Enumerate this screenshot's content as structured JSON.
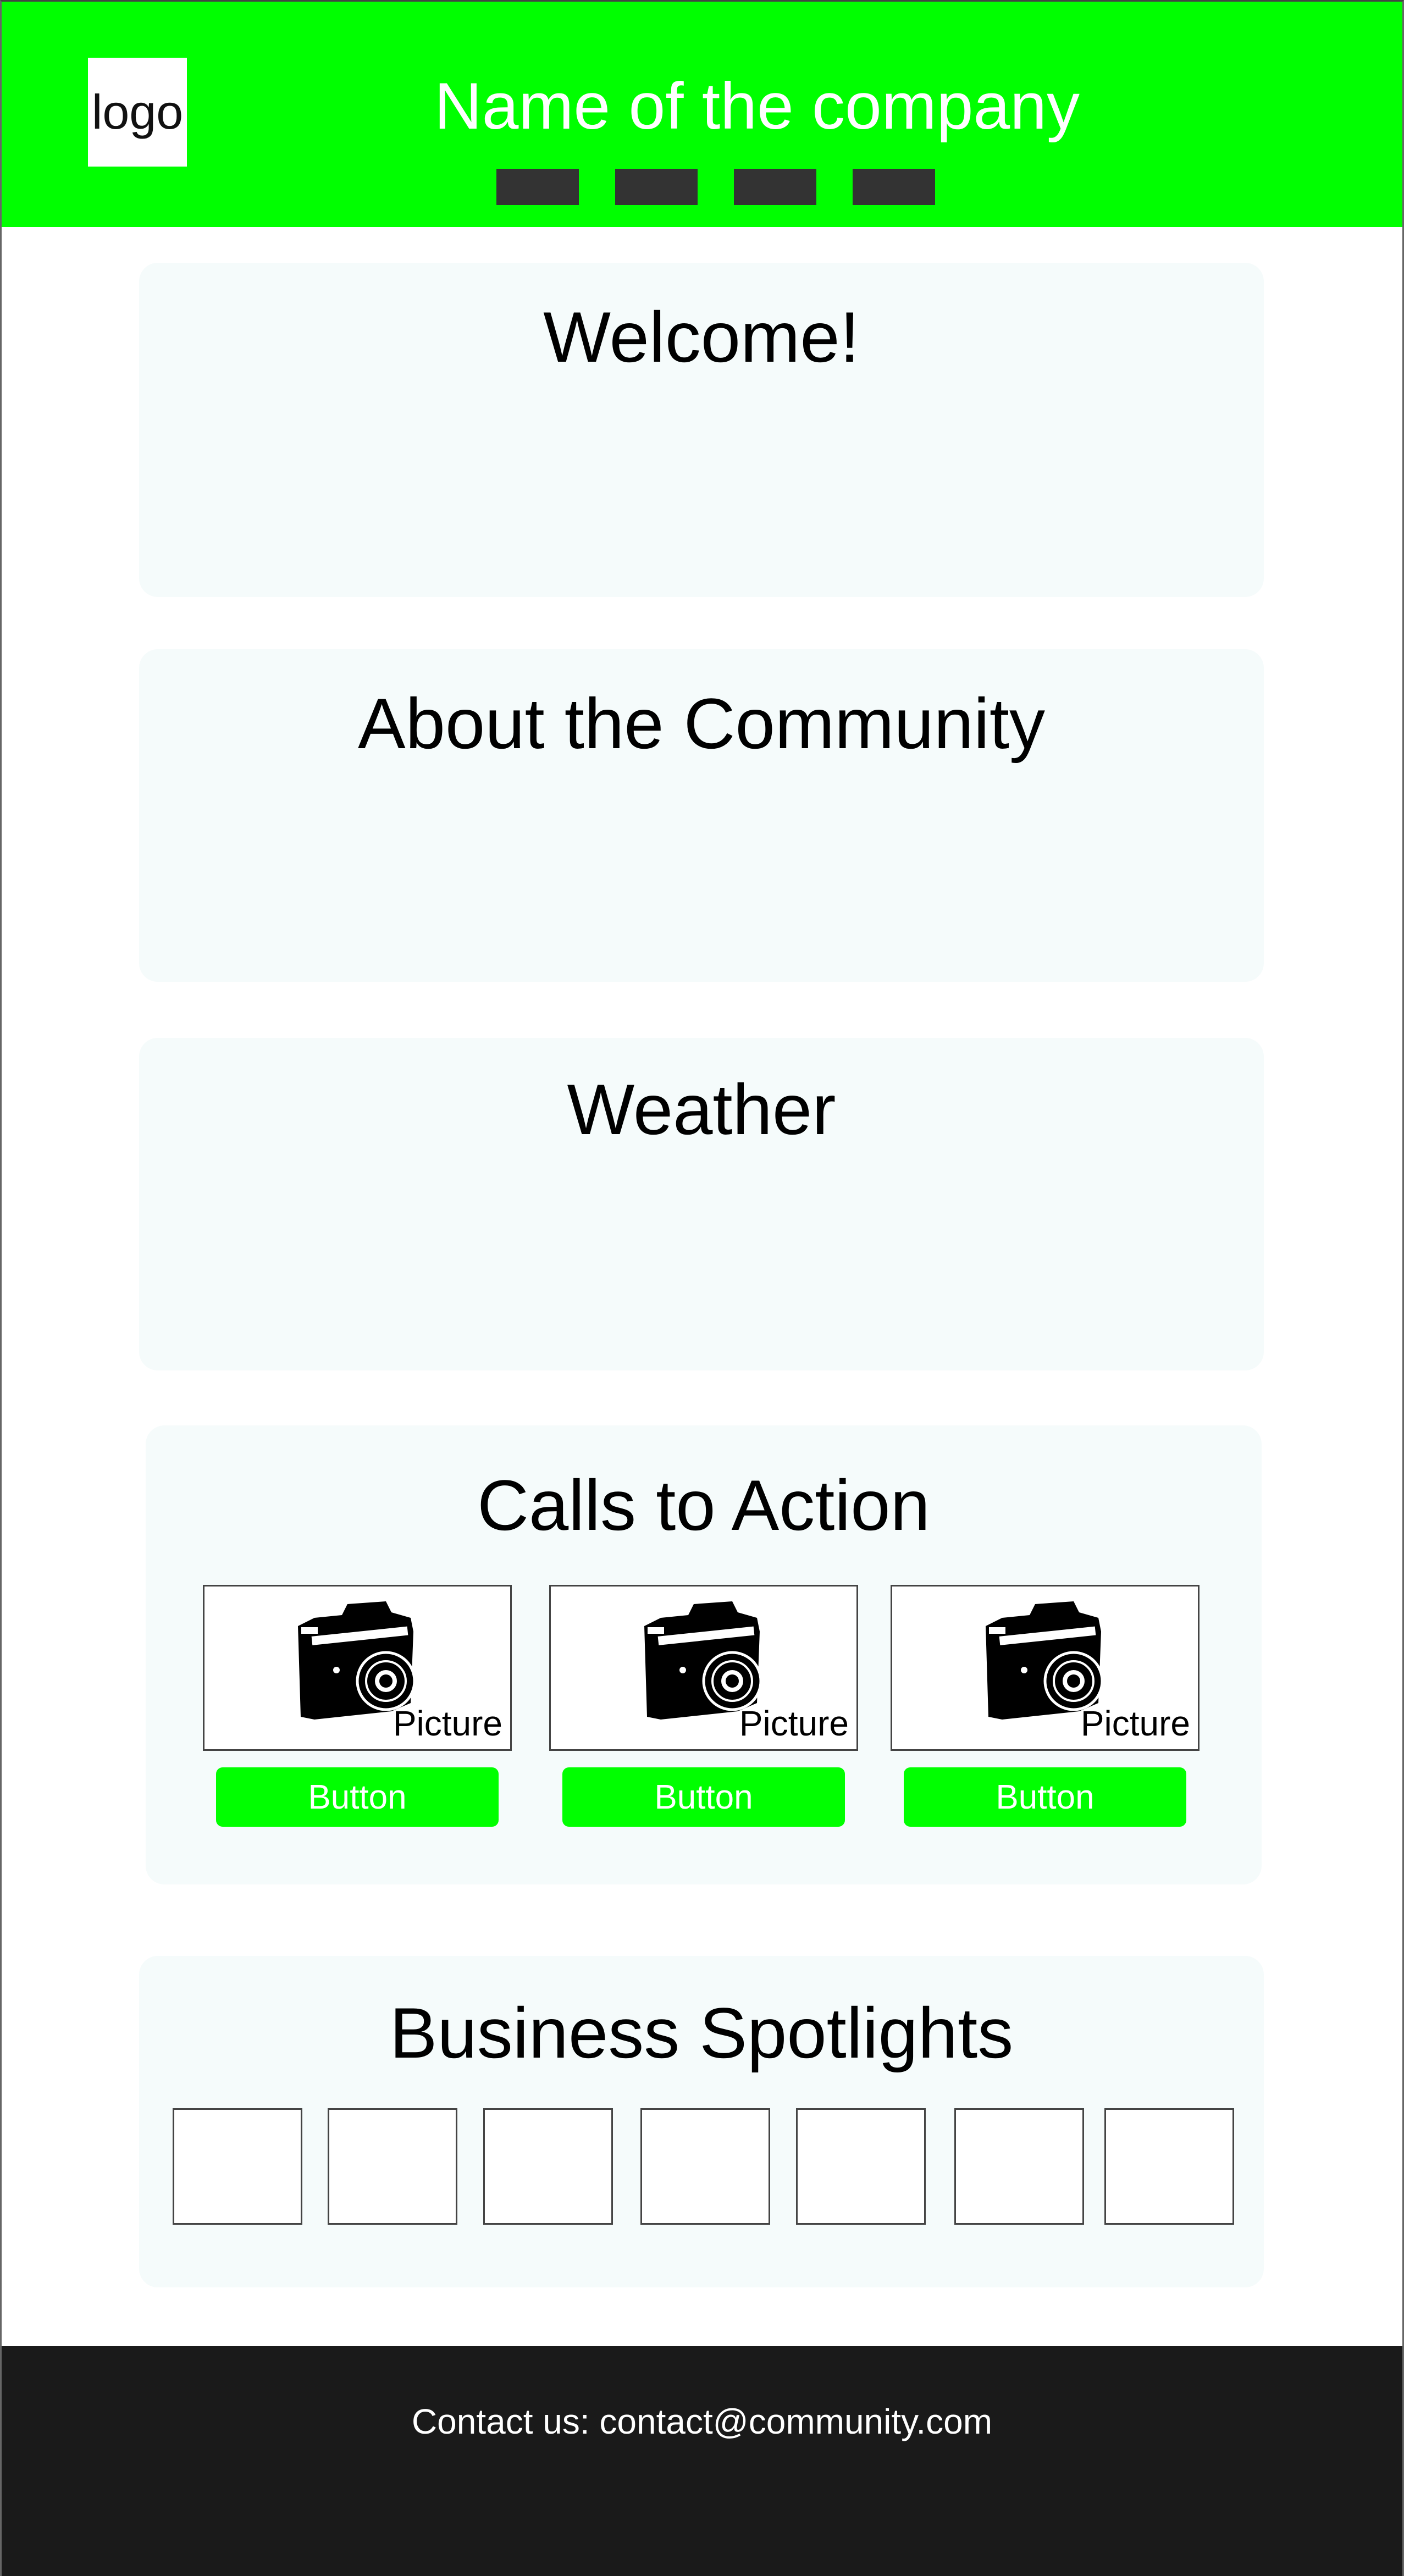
{
  "header": {
    "logo_text": "logo",
    "company_name": "Name of the company",
    "background_color": "#00ff00",
    "nav_items": [
      "",
      "",
      "",
      ""
    ]
  },
  "sections": {
    "welcome": {
      "title": "Welcome!"
    },
    "about": {
      "title": "About the Community"
    },
    "weather": {
      "title": "Weather"
    },
    "cta": {
      "title": "Calls to Action",
      "items": [
        {
          "picture_label": "Picture",
          "icon": "camera-icon",
          "button_label": "Button"
        },
        {
          "picture_label": "Picture",
          "icon": "camera-icon",
          "button_label": "Button"
        },
        {
          "picture_label": "Picture",
          "icon": "camera-icon",
          "button_label": "Button"
        }
      ]
    },
    "spotlights": {
      "title": "Business Spotlights",
      "box_count": 7
    }
  },
  "footer": {
    "contact_text": "Contact us: contact@community.com",
    "background_color": "#1a1a1a"
  },
  "colors": {
    "accent": "#00ff00",
    "card_background": "#f5fbfb",
    "nav_item": "#333333"
  }
}
